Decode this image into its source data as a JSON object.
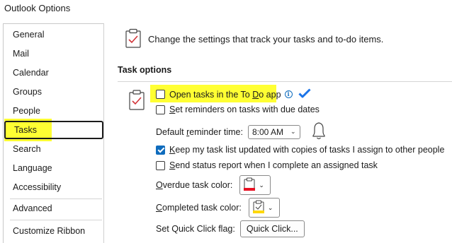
{
  "window": {
    "title": "Outlook Options"
  },
  "sidebar": {
    "items": [
      {
        "label": "General"
      },
      {
        "label": "Mail"
      },
      {
        "label": "Calendar"
      },
      {
        "label": "Groups"
      },
      {
        "label": "People"
      },
      {
        "label": "Tasks",
        "selected": true
      },
      {
        "label": "Search"
      },
      {
        "label": "Language"
      },
      {
        "label": "Accessibility"
      },
      {
        "label": "Advanced"
      },
      {
        "label": "Customize Ribbon"
      }
    ]
  },
  "header": {
    "text": "Change the settings that track your tasks and to-do items.",
    "icon": "tasks-clipboard-icon"
  },
  "section": {
    "title": "Task options",
    "icon": "tasks-clipboard-icon"
  },
  "options": {
    "open_todo": {
      "pre": "Open tasks in the To ",
      "u": "D",
      "post": "o app",
      "checked": false,
      "info_icon": "info-icon",
      "badge_icon": "blue-checkmark-icon"
    },
    "reminders": {
      "pre": "",
      "u": "S",
      "post": "et reminders on tasks with due dates",
      "checked": false
    },
    "default_reminder": {
      "pre": "Default ",
      "u": "r",
      "post": "eminder time:",
      "value": "8:00 AM",
      "icon": "bell-icon"
    },
    "keep_updated": {
      "pre": "",
      "u": "K",
      "post": "eep my task list updated with copies of tasks I assign to other people",
      "checked": true
    },
    "status_report": {
      "pre": "",
      "u": "S",
      "post": "end status report when I complete an assigned task",
      "checked": false
    },
    "overdue_color": {
      "pre": "",
      "u": "O",
      "post": "verdue task color:",
      "swatch": "#e81123"
    },
    "completed_color": {
      "pre": "",
      "u": "C",
      "post": "ompleted task color:",
      "swatch": "#ffd800"
    },
    "quick_click": {
      "label": "Set Quick Click flag:",
      "button_label": "Quick Click..."
    }
  },
  "colors": {
    "accent": "#0f6cbd",
    "highlight": "#ffff33",
    "clipboard_red": "#d13438"
  }
}
